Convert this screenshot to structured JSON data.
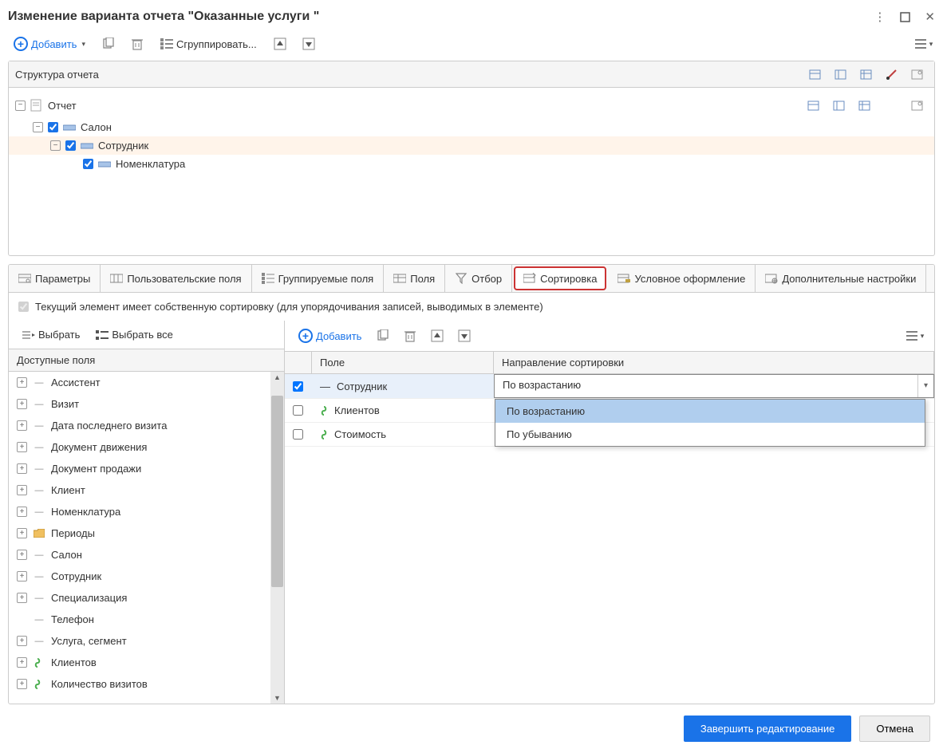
{
  "window": {
    "title": "Изменение варианта отчета \"Оказанные услуги \"",
    "more_icon": "⋮",
    "maximize_icon": "maximize",
    "close_icon": "✕"
  },
  "toolbar": {
    "add": "Добавить",
    "group": "Сгруппировать..."
  },
  "structure": {
    "header": "Структура отчета",
    "root": "Отчет",
    "items": [
      {
        "label": "Салон",
        "checked": true,
        "indent": 1
      },
      {
        "label": "Сотрудник",
        "checked": true,
        "indent": 2,
        "selected": true
      },
      {
        "label": "Номенклатура",
        "checked": true,
        "indent": 3
      }
    ]
  },
  "tabs": [
    {
      "id": "params",
      "label": "Параметры"
    },
    {
      "id": "userfields",
      "label": "Пользовательские поля"
    },
    {
      "id": "groupfields",
      "label": "Группируемые поля"
    },
    {
      "id": "fields",
      "label": "Поля"
    },
    {
      "id": "filter",
      "label": "Отбор"
    },
    {
      "id": "sort",
      "label": "Сортировка",
      "active": true
    },
    {
      "id": "cond",
      "label": "Условное оформление"
    },
    {
      "id": "extra",
      "label": "Дополнительные настройки"
    }
  ],
  "sortNote": "Текущий элемент имеет собственную сортировку (для  упорядочивания записей, выводимых в элементе)",
  "leftToolbar": {
    "select": "Выбрать",
    "selectAll": "Выбрать все"
  },
  "rightToolbar": {
    "add": "Добавить"
  },
  "availableFields": {
    "header": "Доступные поля",
    "items": [
      {
        "label": "Ассистент",
        "expand": true,
        "icon": "ref"
      },
      {
        "label": "Визит",
        "expand": true,
        "icon": "ref"
      },
      {
        "label": "Дата последнего визита",
        "expand": true,
        "icon": "ref"
      },
      {
        "label": "Документ движения",
        "expand": true,
        "icon": "ref"
      },
      {
        "label": "Документ продажи",
        "expand": true,
        "icon": "ref"
      },
      {
        "label": "Клиент",
        "expand": true,
        "icon": "ref"
      },
      {
        "label": "Номенклатура",
        "expand": true,
        "icon": "ref"
      },
      {
        "label": "Периоды",
        "expand": true,
        "icon": "folder"
      },
      {
        "label": "Салон",
        "expand": true,
        "icon": "ref"
      },
      {
        "label": "Сотрудник",
        "expand": true,
        "icon": "ref"
      },
      {
        "label": "Специализация",
        "expand": true,
        "icon": "ref"
      },
      {
        "label": "Телефон",
        "expand": false,
        "icon": "ref"
      },
      {
        "label": "Услуга, сегмент",
        "expand": true,
        "icon": "ref"
      },
      {
        "label": "Клиентов",
        "expand": true,
        "icon": "sum"
      },
      {
        "label": "Количество визитов",
        "expand": true,
        "icon": "sum"
      }
    ]
  },
  "sortGrid": {
    "headers": {
      "field": "Поле",
      "direction": "Направление сортировки"
    },
    "rows": [
      {
        "field": "Сотрудник",
        "direction": "По возрастанию",
        "checked": true,
        "icon": "ref",
        "selected": true,
        "editing": true
      },
      {
        "field": "Клиентов",
        "direction": "",
        "checked": false,
        "icon": "sum"
      },
      {
        "field": "Стоимость",
        "direction": "",
        "checked": false,
        "icon": "sum"
      }
    ],
    "dropdown": {
      "options": [
        "По возрастанию",
        "По убыванию"
      ],
      "hovered": 0
    }
  },
  "footer": {
    "finish": "Завершить редактирование",
    "cancel": "Отмена"
  }
}
